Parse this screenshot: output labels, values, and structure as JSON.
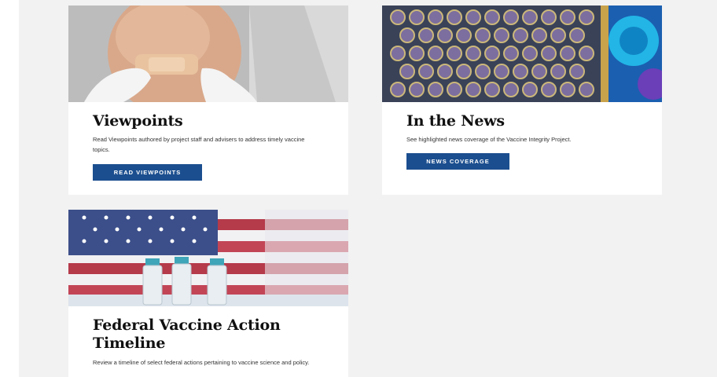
{
  "cards": [
    {
      "title": "Viewpoints",
      "description": "Read Viewpoints authored by project staff and advisers to address timely vaccine topics.",
      "button_label": "READ VIEWPOINTS"
    },
    {
      "title": "In the News",
      "description": "See highlighted news coverage of the Vaccine Integrity Project.",
      "button_label": "NEWS COVERAGE"
    },
    {
      "title": "Federal Vaccine Action Timeline",
      "description": "Review a timeline of select federal actions pertaining to vaccine science and policy."
    }
  ],
  "colors": {
    "page_background": "#f2f2f2",
    "card_background": "#ffffff",
    "button_background": "#1b4e8f",
    "button_text": "#ffffff",
    "title_text": "#111111"
  }
}
